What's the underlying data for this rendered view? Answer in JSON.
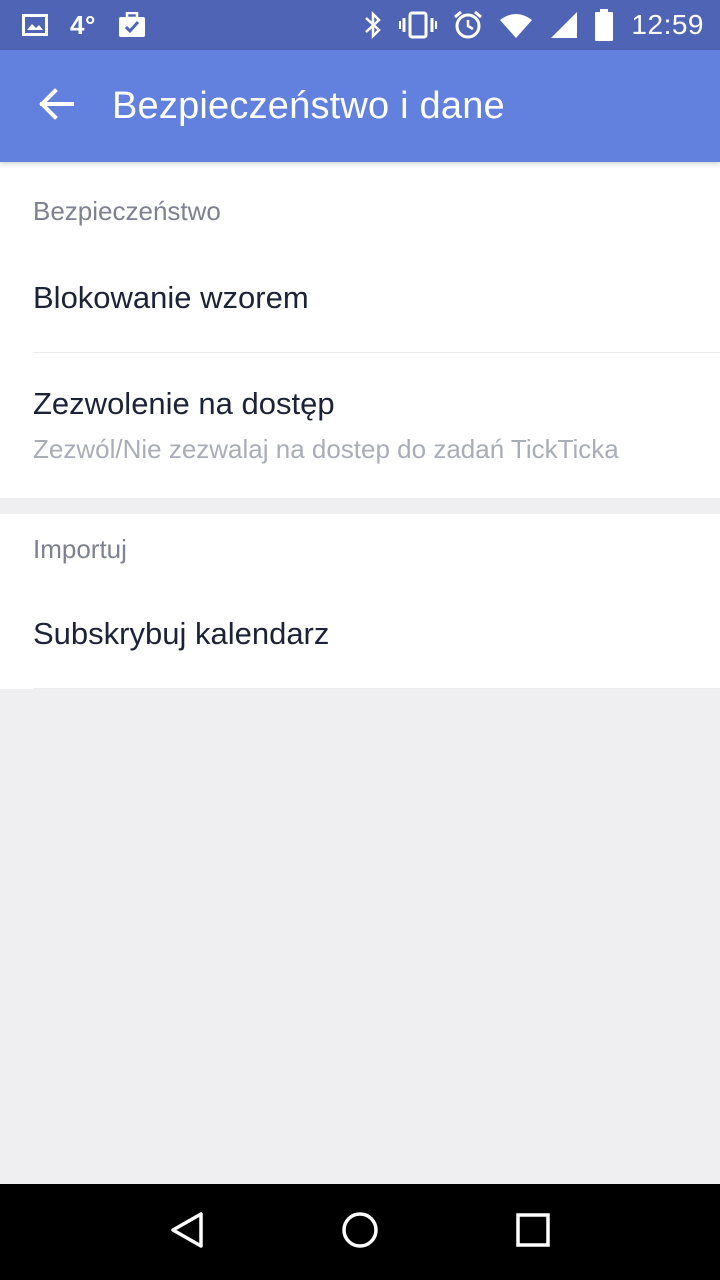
{
  "status_bar": {
    "temperature": "4°",
    "clock": "12:59",
    "icons": [
      "image-icon",
      "weather-icon",
      "briefcase-check-icon",
      "bluetooth-icon",
      "vibrate-icon",
      "alarm-icon",
      "wifi-icon",
      "signal-icon",
      "battery-icon"
    ]
  },
  "app_bar": {
    "title": "Bezpieczeństwo i dane",
    "back_icon": "arrow-left-icon",
    "background": "#6280de"
  },
  "sections": [
    {
      "header": "Bezpieczeństwo",
      "items": [
        {
          "title": "Blokowanie wzorem"
        },
        {
          "title": "Zezwolenie na dostęp",
          "subtitle": "Zezwól/Nie zezwalaj na dostep do zadań TickTicka"
        }
      ]
    },
    {
      "header": "Importuj",
      "items": [
        {
          "title": "Subskrybuj kalendarz"
        }
      ]
    }
  ],
  "nav_bar": {
    "buttons": [
      "back-triangle-icon",
      "home-circle-icon",
      "recents-square-icon"
    ]
  }
}
